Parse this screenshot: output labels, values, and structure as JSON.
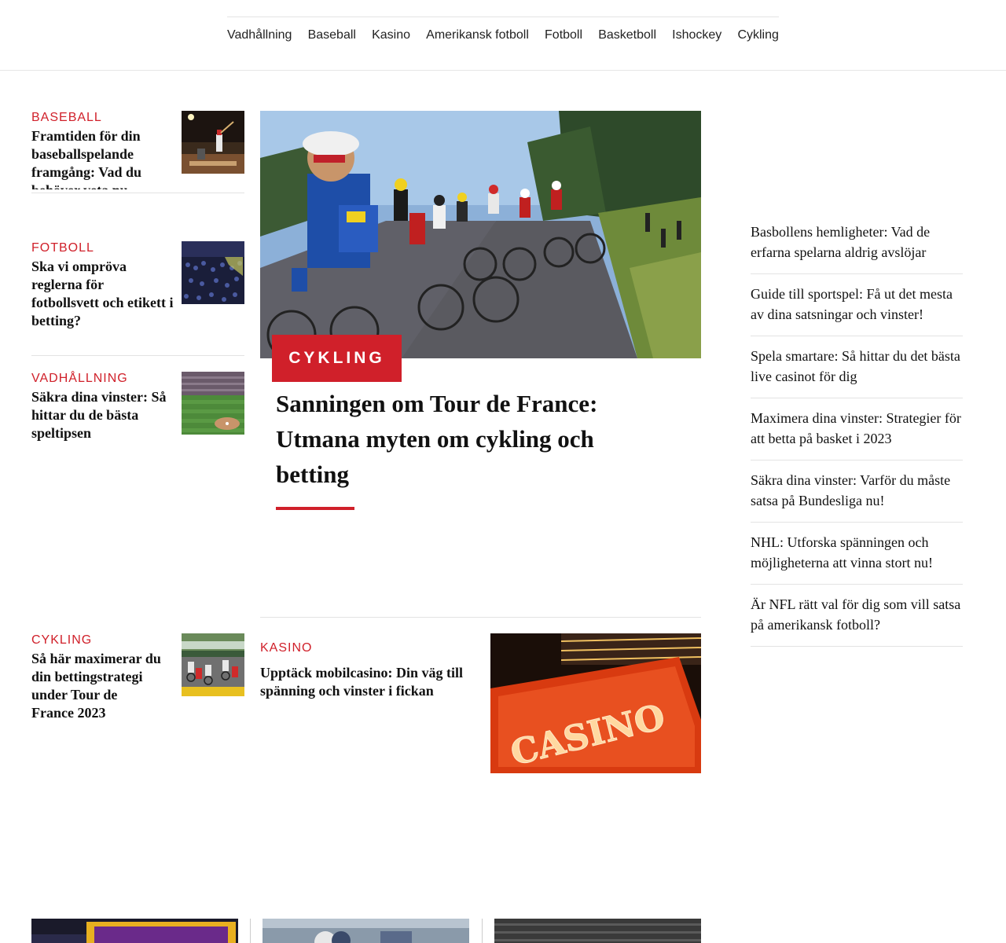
{
  "nav": {
    "items": [
      "Vadhållning",
      "Baseball",
      "Kasino",
      "Amerikansk fotboll",
      "Fotboll",
      "Basketboll",
      "Ishockey",
      "Cykling"
    ]
  },
  "left_cards": [
    {
      "category": "BASEBALL",
      "title": "Framtiden för din baseballspelande framgång: Vad du behöver veta nu",
      "image_icon": "baseball-batter-image"
    },
    {
      "category": "FOTBOLL",
      "title": "Ska vi ompröva reglerna för fotbollsvett och etikett i betting?",
      "image_icon": "stadium-crowd-image"
    },
    {
      "category": "VADHÅLLNING",
      "title": "Säkra dina vinster: Så hittar du de bästa speltipsen",
      "image_icon": "baseball-field-image"
    },
    {
      "category": "CYKLING",
      "title": "Så här maximerar du din bettingstrategi under Tour de France 2023",
      "image_icon": "cycling-race-image"
    }
  ],
  "hero": {
    "category": "CYKLING",
    "title": "Sanningen om Tour de France: Utmana myten om cykling och betting",
    "image_icon": "peloton-image"
  },
  "kasino": {
    "category": "KASINO",
    "title": "Upptäck mobilcasino: Din väg till spänning och vinster i fickan",
    "image_text": "CASINO"
  },
  "sidebar": {
    "items": [
      "Basbollens hemligheter: Vad de erfarna spelarna aldrig avslöjar",
      "Guide till sportspel: Få ut det mesta av dina satsningar och vinster!",
      "Spela smartare: Så hittar du det bästa live casinot för dig",
      "Maximera dina vinster: Strategier för att betta på basket i 2023",
      "Säkra dina vinster: Varför du måste satsa på Bundesliga nu!",
      "NHL: Utforska spänningen och möjligheterna att vinna stort nu!",
      "Är NFL rätt val för dig som vill satsa på amerikansk fotboll?"
    ]
  },
  "colors": {
    "accent": "#d0202a",
    "text": "#111111",
    "rule": "#e3e3e3"
  }
}
